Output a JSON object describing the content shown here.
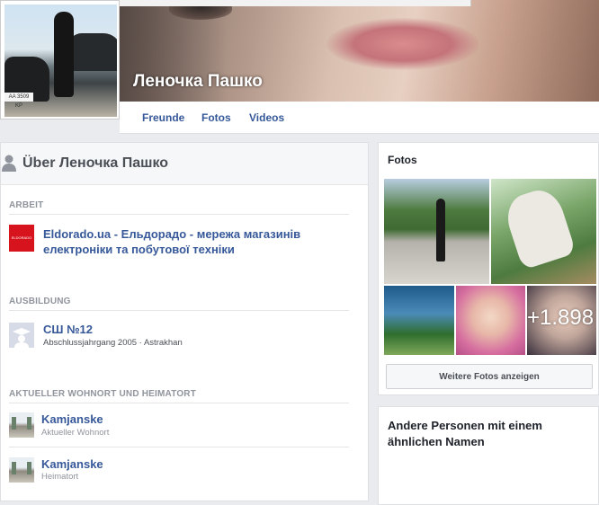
{
  "profile": {
    "name": "Леночка Пашко",
    "plate_text": "AA 3509 KP"
  },
  "nav": {
    "tabs": [
      "Freunde",
      "Fotos",
      "Videos"
    ]
  },
  "about": {
    "title": "Über Леночка Пашко",
    "work": {
      "label": "ARBEIT",
      "employer": "Eldorado.ua - Ельдорадо - мережа магазинів електроніки та побутової техніки",
      "logo_text": "ELDORADO"
    },
    "education": {
      "label": "AUSBILDUNG",
      "school": "СШ №12",
      "details": "Abschlussjahrgang 2005 · Astrakhan"
    },
    "places": {
      "label": "AKTUELLER WOHNORT UND HEIMATORT",
      "current": {
        "name": "Kamjanske",
        "type": "Aktueller Wohnort"
      },
      "hometown": {
        "name": "Kamjanske",
        "type": "Heimatort"
      }
    }
  },
  "photos": {
    "title": "Fotos",
    "more_count": "+1.898",
    "more_button": "Weitere Fotos anzeigen"
  },
  "similar": {
    "title": "Andere Personen mit einem ähnlichen Namen"
  },
  "colors": {
    "link": "#365899",
    "background": "#e9ebee",
    "eldorado_red": "#d7141e"
  }
}
